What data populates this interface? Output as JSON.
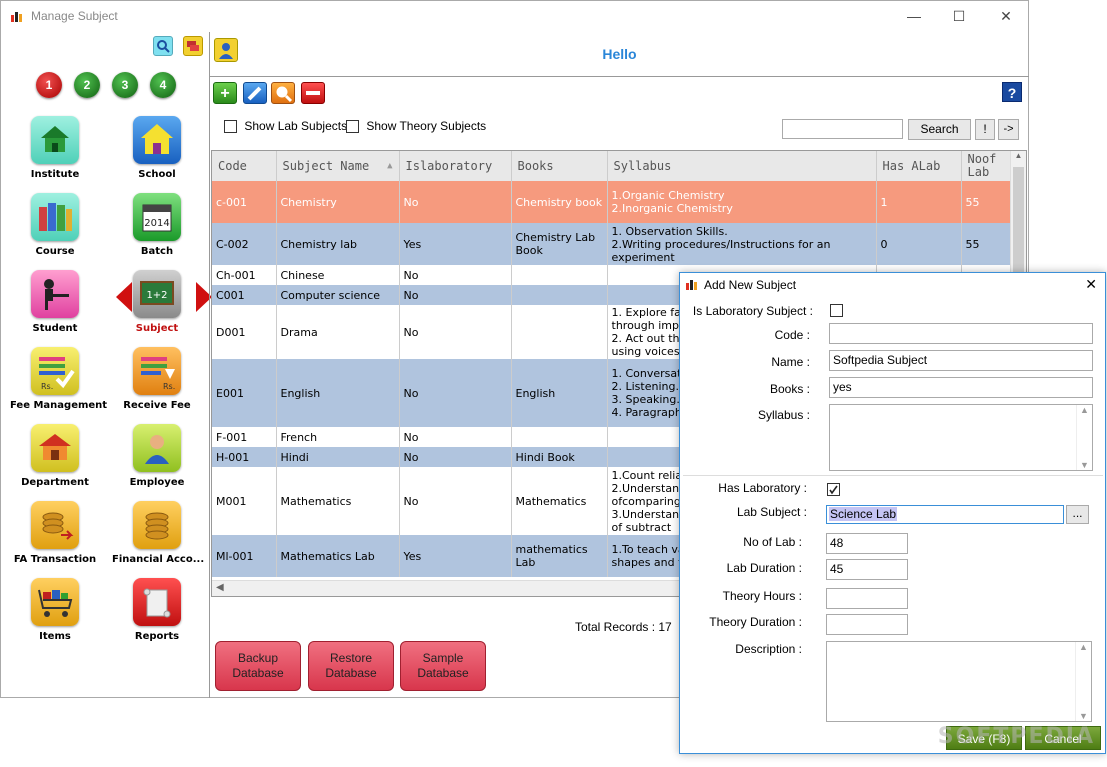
{
  "window": {
    "title": "Manage Subject",
    "controls": {
      "minimize": "—",
      "maximize": "☐",
      "close": "✕"
    }
  },
  "sidebar": {
    "numbers": [
      "1",
      "2",
      "3",
      "4"
    ],
    "tiles": [
      {
        "label": "Institute",
        "icon": "house-icon"
      },
      {
        "label": "School",
        "icon": "school-icon"
      },
      {
        "label": "Course",
        "icon": "books-icon"
      },
      {
        "label": "Batch",
        "icon": "calendar-icon",
        "year": "2014"
      },
      {
        "label": "Student",
        "icon": "student-icon"
      },
      {
        "label": "Subject",
        "icon": "chalkboard-icon",
        "board_text": "1+2"
      },
      {
        "label": "Fee Management",
        "icon": "fee-icon",
        "badge": "Rs."
      },
      {
        "label": "Receive Fee",
        "icon": "receive-fee-icon",
        "badge": "Rs."
      },
      {
        "label": "Department",
        "icon": "department-icon"
      },
      {
        "label": "Employee",
        "icon": "employee-icon"
      },
      {
        "label": "FA Transaction",
        "icon": "coins-transaction-icon"
      },
      {
        "label": "Financial Acco...",
        "icon": "coins-icon"
      },
      {
        "label": "Items",
        "icon": "cart-icon"
      },
      {
        "label": "Reports",
        "icon": "scroll-icon"
      }
    ]
  },
  "header": {
    "greeting": "Hello",
    "help": "?"
  },
  "toolbar": {
    "show_lab": "Show Lab Subjects",
    "show_theory": "Show Theory Subjects",
    "search_placeholder": "",
    "search_button": "Search",
    "bang_button": "!",
    "arrow_button": "->"
  },
  "grid": {
    "columns": [
      "Code",
      "Subject Name",
      "Islaboratory",
      "Books",
      "Syllabus",
      "Has ALab",
      "Noof Lab"
    ],
    "rows": [
      {
        "code": "c-001",
        "name": "Chemistry",
        "islab": "No",
        "books": "Chemistry book",
        "syllabus": "1.Organic Chemistry\n2.Inorganic Chemistry",
        "has_alab": "1",
        "noof_lab": "55"
      },
      {
        "code": "C-002",
        "name": "Chemistry lab",
        "islab": "Yes",
        "books": "Chemistry Lab Book",
        "syllabus": "1. Observation Skills.\n2.Writing procedures/Instructions for an experiment",
        "has_alab": "0",
        "noof_lab": "55"
      },
      {
        "code": "Ch-001",
        "name": "Chinese",
        "islab": "No",
        "books": "",
        "syllabus": "",
        "has_alab": "",
        "noof_lab": ""
      },
      {
        "code": "C001",
        "name": "Computer science",
        "islab": "No",
        "books": "",
        "syllabus": "",
        "has_alab": "",
        "noof_lab": ""
      },
      {
        "code": "D001",
        "name": "Drama",
        "islab": "No",
        "books": "",
        "syllabus": "1. Explore fa\nthrough impr\n2. Act out the\nusing voices",
        "has_alab": "",
        "noof_lab": ""
      },
      {
        "code": "E001",
        "name": "English",
        "islab": "No",
        "books": "English",
        "syllabus": "1. Conversat\n2. Listening.\n3. Speaking.\n4. Paragraph",
        "has_alab": "",
        "noof_lab": ""
      },
      {
        "code": "F-001",
        "name": "French",
        "islab": "No",
        "books": "",
        "syllabus": "",
        "has_alab": "",
        "noof_lab": ""
      },
      {
        "code": "H-001",
        "name": "Hindi",
        "islab": "No",
        "books": "Hindi Book",
        "syllabus": "",
        "has_alab": "",
        "noof_lab": ""
      },
      {
        "code": "M001",
        "name": "Mathematics",
        "islab": "No",
        "books": "Mathematics",
        "syllabus": "1.Count relia\n2.Understand\nofcomparing\n3.Understand\nof    subtract",
        "has_alab": "",
        "noof_lab": ""
      },
      {
        "code": "Ml-001",
        "name": "Mathematics Lab",
        "islab": "Yes",
        "books": "mathematics Lab",
        "syllabus": "1.To teach va\nshapes and t",
        "has_alab": "",
        "noof_lab": ""
      }
    ],
    "total_label": "Total Records : 17"
  },
  "bottom_buttons": {
    "backup": "Backup Database",
    "restore": "Restore Database",
    "sample": "Sample Database"
  },
  "dialog": {
    "title": "Add New Subject",
    "close": "✕",
    "labels": {
      "is_lab": "Is Laboratory Subject :",
      "code": "Code :",
      "name": "Name :",
      "books": "Books :",
      "syllabus": "Syllabus :",
      "has_lab": "Has Laboratory :",
      "lab_subject": "Lab Subject :",
      "no_of_lab": "No of Lab :",
      "lab_duration": "Lab Duration :",
      "theory_hours": "Theory Hours :",
      "theory_duration": "Theory Duration :",
      "description": "Description :"
    },
    "values": {
      "code": "",
      "name": "Softpedia Subject",
      "books": "yes",
      "lab_subject": "Science Lab",
      "no_of_lab": "48",
      "lab_duration": "45",
      "theory_hours": "",
      "theory_duration": ""
    },
    "browse": "...",
    "save": "Save (F8)",
    "cancel": "Cancel",
    "watermark": "SOFTPEDIA"
  },
  "colors": {
    "selected_row": "#f69a7e",
    "alt_row": "#b0c4de",
    "accent": "#2a86d8",
    "db_button": "#e04860"
  }
}
